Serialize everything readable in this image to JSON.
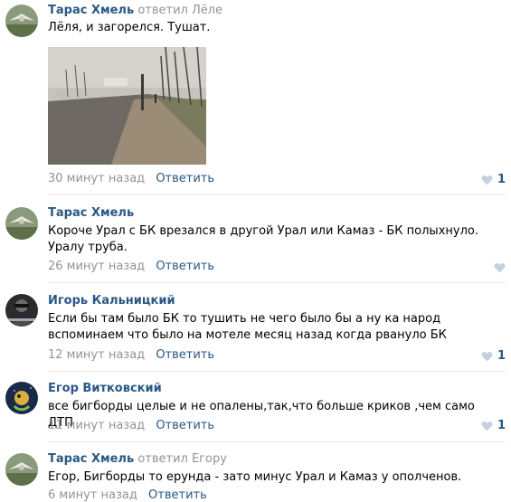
{
  "comments": [
    {
      "author": "Тарас Хмель",
      "reply_to": "ответил Лёле",
      "text": "Лёля, и загорелся. Тушат.",
      "time": "30 минут назад",
      "reply_label": "Ответить",
      "likes": "1"
    },
    {
      "author": "Тарас Хмель",
      "reply_to": "",
      "text": "Короче Урал с БК врезался в другой Урал или Камаз - БК полыхнуло. Уралу труба.",
      "time": "26 минут назад",
      "reply_label": "Ответить",
      "likes": ""
    },
    {
      "author": "Игорь Кальницкий",
      "reply_to": "",
      "text": "Если бы там было БК то тушить не чего было бы а ну ка народ вспоминаем что было на мотеле месяц назад когда рвануло БК",
      "time": "12 минут назад",
      "reply_label": "Ответить",
      "likes": "1"
    },
    {
      "author": "Егор Витковский",
      "reply_to": "",
      "text": "все бигборды целые и не опалены,так,что больше криков ,чем само ДТП",
      "time": "11 минут назад",
      "reply_label": "Ответить",
      "likes": "1"
    },
    {
      "author": "Тарас Хмель",
      "reply_to": "ответил Егору",
      "text": "Егор, Бигборды то ерунда - зато минус Урал и Камаз у ополченов.",
      "time": "6 минут назад",
      "reply_label": "Ответить",
      "likes": ""
    }
  ],
  "colors": {
    "link": "#2a5885",
    "muted": "#939393",
    "separator": "#e7e8ec"
  }
}
